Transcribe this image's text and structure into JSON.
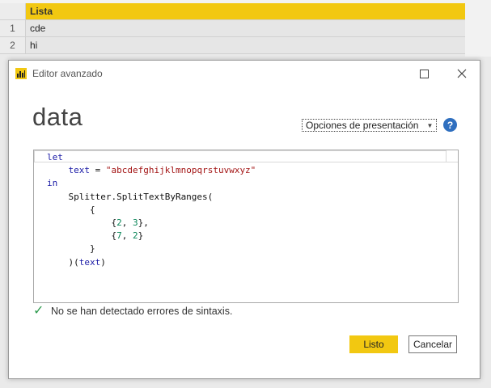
{
  "table": {
    "header": "Lista",
    "rows": [
      {
        "index": "1",
        "value": "cde"
      },
      {
        "index": "2",
        "value": "hi"
      }
    ]
  },
  "dialog": {
    "title": "Editor avanzado",
    "heading": "data",
    "display_options_label": "Opciones de presentación",
    "help_icon": "help-icon",
    "code_lines": [
      "let",
      "    text = \"abcdefghijklmnopqrstuvwxyz\"",
      "in",
      "    Splitter.SplitTextByRanges(",
      "        {",
      "            {2, 3},",
      "            {7, 2}",
      "        }",
      "    )(text)"
    ],
    "status_text": "No se han detectado errores de sintaxis.",
    "done_label": "Listo",
    "cancel_label": "Cancelar"
  },
  "colors": {
    "accent": "#f2c811",
    "success": "#2e9b4e",
    "help": "#2f6fbf"
  }
}
